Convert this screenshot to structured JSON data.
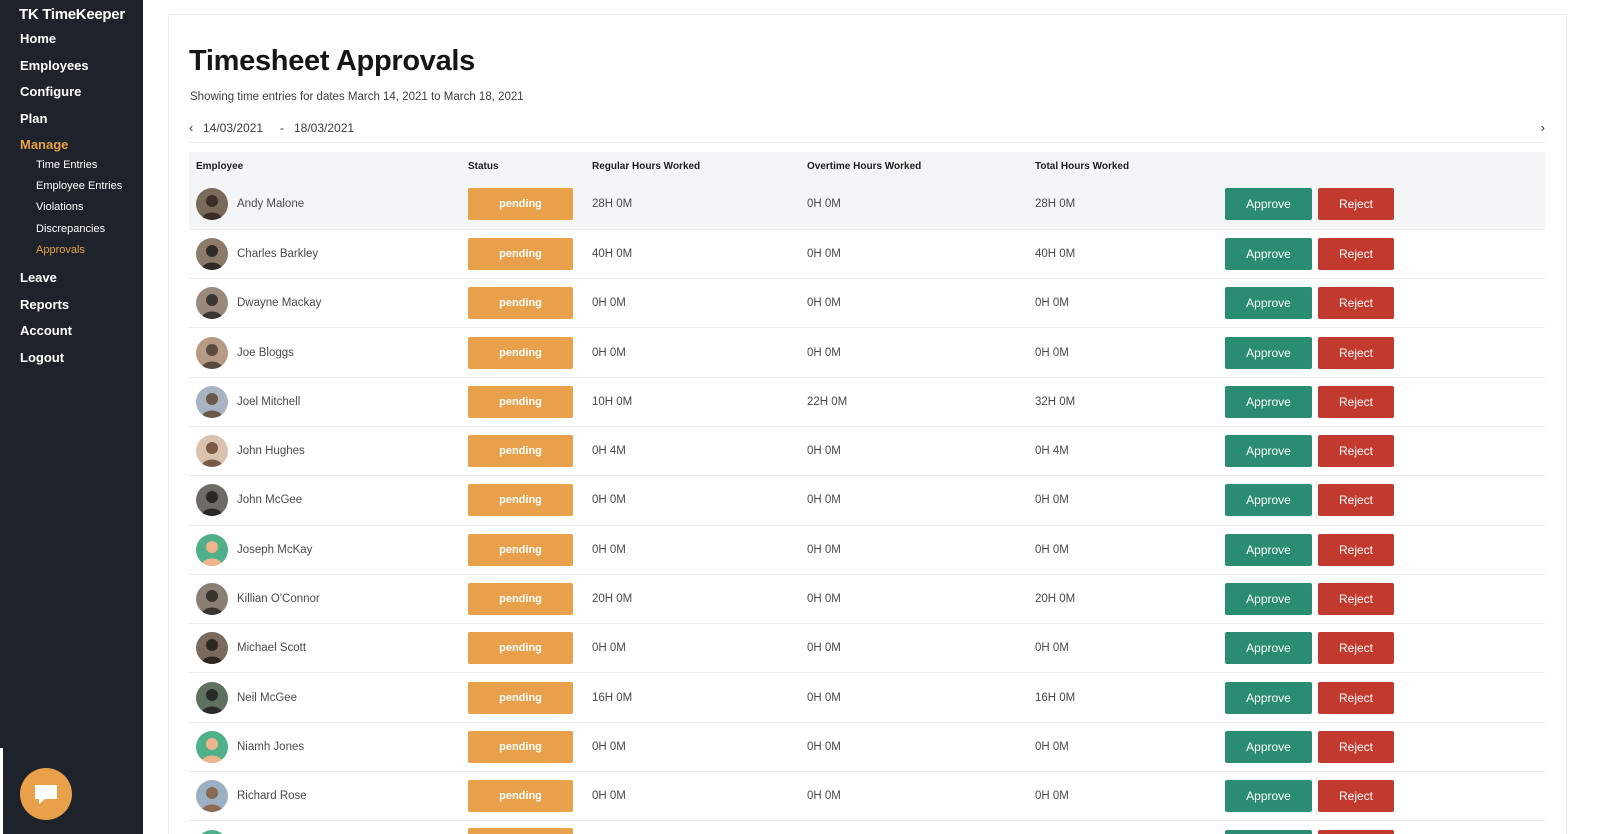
{
  "brand": "TK TimeKeeper",
  "nav": {
    "home": "Home",
    "employees": "Employees",
    "configure": "Configure",
    "plan": "Plan",
    "manage": "Manage",
    "manage_sub": [
      "Time Entries",
      "Employee Entries",
      "Violations",
      "Discrepancies",
      "Approvals"
    ],
    "leave": "Leave",
    "reports": "Reports",
    "account": "Account",
    "logout": "Logout"
  },
  "page": {
    "title": "Timesheet Approvals",
    "subtitle": "Showing time entries for dates March 14, 2021 to March 18, 2021",
    "date_start": "14/03/2021",
    "date_sep": "-",
    "date_end": "18/03/2021",
    "prev_icon": "‹",
    "next_icon": "›"
  },
  "table": {
    "headers": [
      "Employee",
      "Status",
      "Regular Hours Worked",
      "Overtime Hours Worked",
      "Total Hours Worked"
    ],
    "approve_label": "Approve",
    "reject_label": "Reject",
    "rows": [
      {
        "name": "Andy Malone",
        "status": "pending",
        "regular": "28H 0M",
        "overtime": "0H 0M",
        "total": "28H 0M"
      },
      {
        "name": "Charles Barkley",
        "status": "pending",
        "regular": "40H 0M",
        "overtime": "0H 0M",
        "total": "40H 0M"
      },
      {
        "name": "Dwayne Mackay",
        "status": "pending",
        "regular": "0H 0M",
        "overtime": "0H 0M",
        "total": "0H 0M"
      },
      {
        "name": "Joe Bloggs",
        "status": "pending",
        "regular": "0H 0M",
        "overtime": "0H 0M",
        "total": "0H 0M"
      },
      {
        "name": "Joel Mitchell",
        "status": "pending",
        "regular": "10H 0M",
        "overtime": "22H 0M",
        "total": "32H 0M"
      },
      {
        "name": "John Hughes",
        "status": "pending",
        "regular": "0H 4M",
        "overtime": "0H 0M",
        "total": "0H 4M"
      },
      {
        "name": "John McGee",
        "status": "pending",
        "regular": "0H 0M",
        "overtime": "0H 0M",
        "total": "0H 0M"
      },
      {
        "name": "Joseph McKay",
        "status": "pending",
        "regular": "0H 0M",
        "overtime": "0H 0M",
        "total": "0H 0M"
      },
      {
        "name": "Killian O'Connor",
        "status": "pending",
        "regular": "20H 0M",
        "overtime": "0H 0M",
        "total": "20H 0M"
      },
      {
        "name": "Michael Scott",
        "status": "pending",
        "regular": "0H 0M",
        "overtime": "0H 0M",
        "total": "0H 0M"
      },
      {
        "name": "Neil McGee",
        "status": "pending",
        "regular": "16H 0M",
        "overtime": "0H 0M",
        "total": "16H 0M"
      },
      {
        "name": "Niamh Jones",
        "status": "pending",
        "regular": "0H 0M",
        "overtime": "0H 0M",
        "total": "0H 0M"
      },
      {
        "name": "Richard Rose",
        "status": "pending",
        "regular": "0H 0M",
        "overtime": "0H 0M",
        "total": "0H 0M"
      },
      {
        "name": "",
        "status": "",
        "regular": "",
        "overtime": "",
        "total": ""
      }
    ]
  },
  "colors": {
    "sidebar_bg": "#1e232b",
    "accent": "#e8a04a",
    "approve": "#2a8c72",
    "reject": "#c23a2d"
  },
  "icons": {
    "chat": "chat-bubble-icon"
  }
}
